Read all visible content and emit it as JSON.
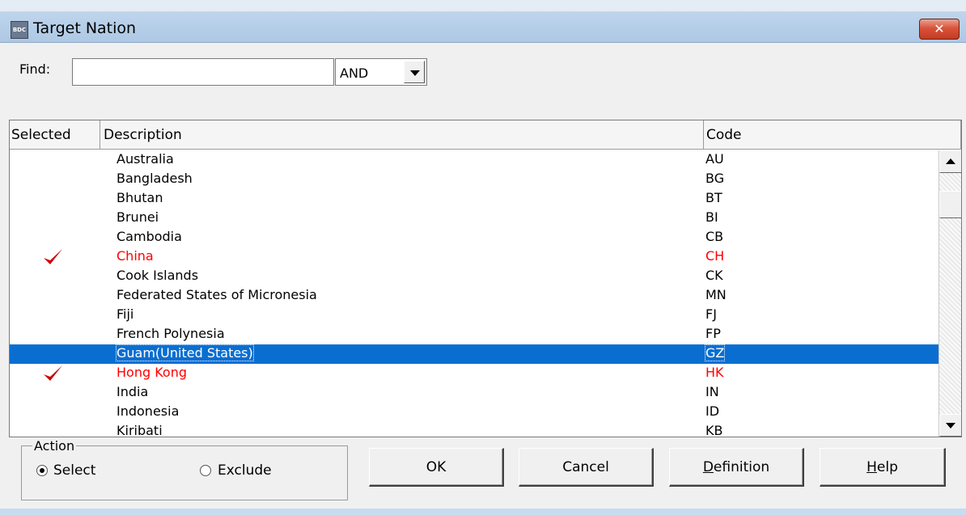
{
  "window": {
    "title": "Target Nation",
    "icon_text": "BDC",
    "close_label": "✕"
  },
  "find": {
    "label": "Find:",
    "value": "",
    "operator": "AND"
  },
  "grid": {
    "columns": [
      "Selected",
      "Description",
      "Code"
    ],
    "rows": [
      {
        "checked": false,
        "description": "Australia",
        "code": "AU",
        "selected": false
      },
      {
        "checked": false,
        "description": "Bangladesh",
        "code": "BG",
        "selected": false
      },
      {
        "checked": false,
        "description": "Bhutan",
        "code": "BT",
        "selected": false
      },
      {
        "checked": false,
        "description": "Brunei",
        "code": "BI",
        "selected": false
      },
      {
        "checked": false,
        "description": "Cambodia",
        "code": "CB",
        "selected": false
      },
      {
        "checked": true,
        "description": "China",
        "code": "CH",
        "selected": false
      },
      {
        "checked": false,
        "description": "Cook Islands",
        "code": "CK",
        "selected": false
      },
      {
        "checked": false,
        "description": "Federated States of Micronesia",
        "code": "MN",
        "selected": false
      },
      {
        "checked": false,
        "description": "Fiji",
        "code": "FJ",
        "selected": false
      },
      {
        "checked": false,
        "description": "French Polynesia",
        "code": "FP",
        "selected": false
      },
      {
        "checked": false,
        "description": "Guam(United States)",
        "code": "GZ",
        "selected": true
      },
      {
        "checked": true,
        "description": "Hong Kong",
        "code": "HK",
        "selected": false
      },
      {
        "checked": false,
        "description": "India",
        "code": "IN",
        "selected": false
      },
      {
        "checked": false,
        "description": "Indonesia",
        "code": "ID",
        "selected": false
      },
      {
        "checked": false,
        "description": "Kiribati",
        "code": "KB",
        "selected": false
      }
    ]
  },
  "action": {
    "legend": "Action",
    "select_label": "Select",
    "exclude_label": "Exclude",
    "selected": "select"
  },
  "buttons": {
    "ok": "OK",
    "cancel": "Cancel",
    "definition_first": "D",
    "definition_rest": "efinition",
    "help_first": "H",
    "help_rest": "elp"
  },
  "colors": {
    "checked_text": "#ff0000",
    "selection": "#0a6ed1",
    "checkmark": "#cc0000"
  }
}
